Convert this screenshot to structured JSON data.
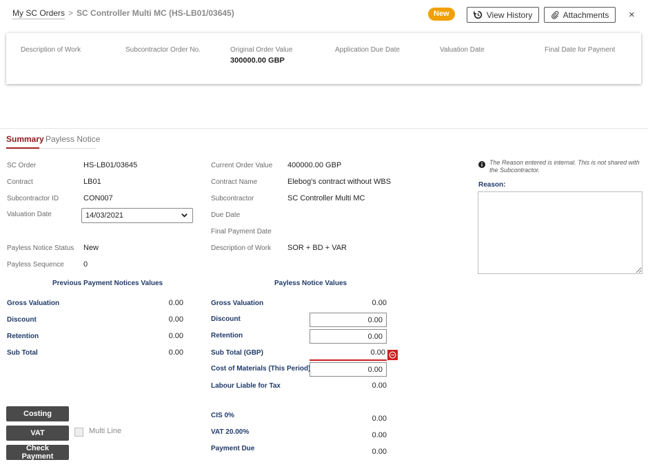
{
  "breadcrumb": {
    "root": "My SC Orders",
    "separator": ">",
    "current": "SC Controller Multi MC (HS-LB01/03645)"
  },
  "header": {
    "status_badge": "New",
    "view_history": "View History",
    "attachments": "Attachments",
    "close": "×"
  },
  "summary_card": {
    "description_of_work": "Description of Work",
    "subcontractor_order_no": "Subcontractor Order No.",
    "original_order_value_label": "Original Order Value",
    "original_order_value": "300000.00 GBP",
    "application_due_date": "Application Due Date",
    "valuation_date": "Valuation Date",
    "final_date_for_payment": "Final Date for Payment"
  },
  "tabs": {
    "summary": "Summary",
    "payless_notice": "Payless Notice"
  },
  "details": {
    "sc_order_label": "SC Order",
    "sc_order": "HS-LB01/03645",
    "contract_label": "Contract",
    "contract": "LB01",
    "subcontractor_id_label": "Subcontractor ID",
    "subcontractor_id": "CON007",
    "valuation_date_label": "Valuation Date",
    "valuation_date": "14/03/2021",
    "payless_status_label": "Payless Notice Status",
    "payless_status": "New",
    "payless_sequence_label": "Payless Sequence",
    "payless_sequence": "0",
    "current_order_value_label": "Current Order Value",
    "current_order_value": "400000.00 GBP",
    "contract_name_label": "Contract Name",
    "contract_name": "Elebog's contract without WBS",
    "subcontractor_label": "Subcontractor",
    "subcontractor": "SC Controller Multi MC",
    "due_date_label": "Due Date",
    "final_payment_date_label": "Final Payment Date",
    "description_of_work_label": "Description of Work",
    "description_of_work": "SOR + BD + VAR"
  },
  "previous": {
    "title": "Previous Payment Notices Values",
    "gross_valuation_label": "Gross Valuation",
    "gross_valuation": "0.00",
    "discount_label": "Discount",
    "discount": "0.00",
    "retention_label": "Retention",
    "retention": "0.00",
    "sub_total_label": "Sub Total",
    "sub_total": "0.00"
  },
  "payless": {
    "title": "Payless Notice Values",
    "gross_valuation_label": "Gross Valuation",
    "gross_valuation": "0.00",
    "discount_label": "Discount",
    "discount": "0.00",
    "retention_label": "Retention",
    "retention": "0.00",
    "sub_total_label": "Sub Total (GBP)",
    "sub_total": "0.00",
    "cost_of_materials_label": "Cost of Materials (This Period)",
    "cost_of_materials": "0.00",
    "labour_liable_label": "Labour Liable for Tax",
    "labour_liable": "0.00",
    "cis_label": "CIS 0%",
    "cis": "0.00",
    "vat_label": "VAT 20.00%",
    "vat": "0.00",
    "payment_due_label": "Payment Due",
    "payment_due": "0.00"
  },
  "actions": {
    "costing": "Costing",
    "vat": "VAT",
    "multi_line": "Multi Line",
    "check_payment": "Check Payment"
  },
  "reason": {
    "info": "The Reason entered is internal. This is not shared with the Subcontractor.",
    "label": "Reason:",
    "value": ""
  },
  "colors": {
    "accent": "#a61f1f",
    "badge": "#f0a000",
    "section_blue": "#1f3a68",
    "error": "#cc1f1f",
    "dark_button": "#4a4a4a"
  }
}
